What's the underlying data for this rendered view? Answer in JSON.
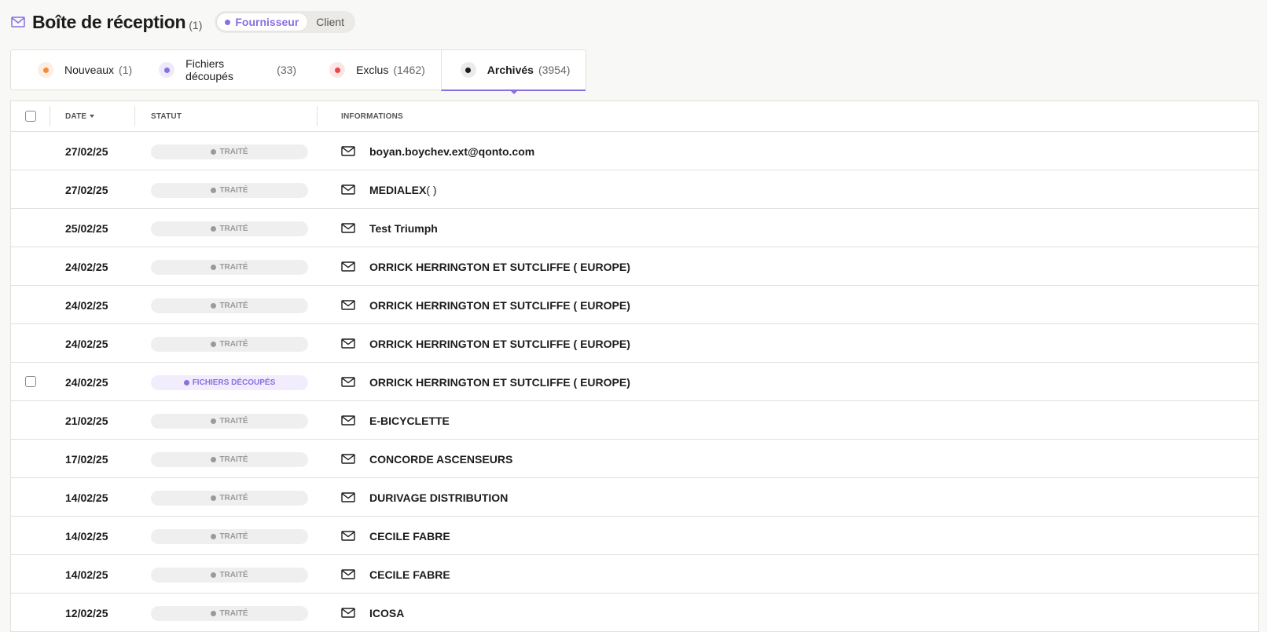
{
  "header": {
    "title": "Boîte de réception",
    "count": "(1)",
    "switch": {
      "options": [
        "Fournisseur",
        "Client"
      ],
      "active": "Fournisseur"
    }
  },
  "tabs": [
    {
      "label": "Nouveaux",
      "count": "(1)",
      "dot_color": "#f28c3c"
    },
    {
      "label": "Fichiers découpés",
      "count": "(33)",
      "dot_color": "#8a6fe0"
    },
    {
      "label": "Exclus",
      "count": "(1462)",
      "dot_color": "#ef4444"
    },
    {
      "label": "Archivés",
      "count": "(3954)",
      "dot_color": "#1c1c1c",
      "active": true
    }
  ],
  "table": {
    "columns": {
      "date": "DATE",
      "status": "STATUT",
      "info": "INFORMATIONS"
    },
    "rows": [
      {
        "date": "27/02/25",
        "status": "TRAITÉ",
        "info": "boyan.boychev.ext@qonto.com",
        "suffix": ""
      },
      {
        "date": "27/02/25",
        "status": "TRAITÉ",
        "info": "MEDIALEX",
        "suffix": " ( )"
      },
      {
        "date": "25/02/25",
        "status": "TRAITÉ",
        "info": "Test Triumph",
        "suffix": ""
      },
      {
        "date": "24/02/25",
        "status": "TRAITÉ",
        "info": "ORRICK HERRINGTON ET SUTCLIFFE ( EUROPE)",
        "suffix": ""
      },
      {
        "date": "24/02/25",
        "status": "TRAITÉ",
        "info": "ORRICK HERRINGTON ET SUTCLIFFE ( EUROPE)",
        "suffix": ""
      },
      {
        "date": "24/02/25",
        "status": "TRAITÉ",
        "info": "ORRICK HERRINGTON ET SUTCLIFFE ( EUROPE)",
        "suffix": ""
      },
      {
        "date": "24/02/25",
        "status": "FICHIERS DÉCOUPÉS",
        "info": "ORRICK HERRINGTON ET SUTCLIFFE ( EUROPE)",
        "suffix": "",
        "checkbox": true
      },
      {
        "date": "21/02/25",
        "status": "TRAITÉ",
        "info": "E-BICYCLETTE",
        "suffix": ""
      },
      {
        "date": "17/02/25",
        "status": "TRAITÉ",
        "info": "CONCORDE ASCENSEURS",
        "suffix": ""
      },
      {
        "date": "14/02/25",
        "status": "TRAITÉ",
        "info": "DURIVAGE DISTRIBUTION",
        "suffix": ""
      },
      {
        "date": "14/02/25",
        "status": "TRAITÉ",
        "info": "CECILE FABRE",
        "suffix": ""
      },
      {
        "date": "14/02/25",
        "status": "TRAITÉ",
        "info": "CECILE FABRE",
        "suffix": ""
      },
      {
        "date": "12/02/25",
        "status": "TRAITÉ",
        "info": "ICOSA",
        "suffix": ""
      }
    ]
  },
  "colors": {
    "accent": "#8a6fe0",
    "background": "#f8f8f6",
    "border": "#e2e0dc"
  }
}
